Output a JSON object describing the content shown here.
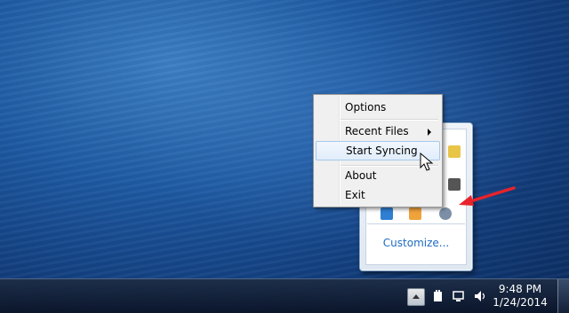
{
  "context_menu": {
    "items": [
      {
        "label": "Options"
      },
      {
        "label": "Recent Files",
        "has_submenu": true
      },
      {
        "label": "Start Syncing",
        "highlighted": true
      },
      {
        "label": "About"
      },
      {
        "label": "Exit"
      }
    ]
  },
  "tray_panel": {
    "customize_label": "Customize..."
  },
  "taskbar": {
    "time": "9:48 PM",
    "date": "1/24/2014"
  },
  "colors": {
    "highlight_border": "#a7c8ec",
    "annotation_arrow": "#e8232b",
    "link": "#1f6bc2"
  }
}
